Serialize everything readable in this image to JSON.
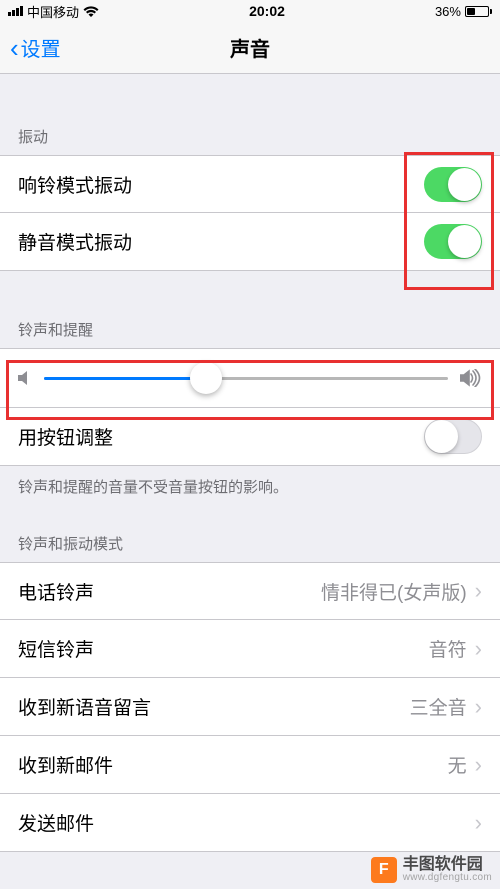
{
  "statusBar": {
    "carrier": "中国移动",
    "time": "20:02",
    "batteryPercent": "36%"
  },
  "nav": {
    "back": "设置",
    "title": "声音"
  },
  "sections": {
    "vibration": {
      "header": "振动",
      "items": [
        {
          "label": "响铃模式振动",
          "on": true
        },
        {
          "label": "静音模式振动",
          "on": true
        }
      ]
    },
    "ringtone": {
      "header": "铃声和提醒",
      "sliderValue": 0.4,
      "buttonAdjust": {
        "label": "用按钮调整",
        "on": false
      },
      "footer": "铃声和提醒的音量不受音量按钮的影响。"
    },
    "patterns": {
      "header": "铃声和振动模式",
      "items": [
        {
          "label": "电话铃声",
          "value": "情非得已(女声版)"
        },
        {
          "label": "短信铃声",
          "value": "音符"
        },
        {
          "label": "收到新语音留言",
          "value": "三全音"
        },
        {
          "label": "收到新邮件",
          "value": "无"
        },
        {
          "label": "发送邮件",
          "value": ""
        }
      ]
    }
  },
  "watermark": {
    "title": "丰图软件园",
    "url": "www.dgfengtu.com",
    "logo": "F"
  }
}
